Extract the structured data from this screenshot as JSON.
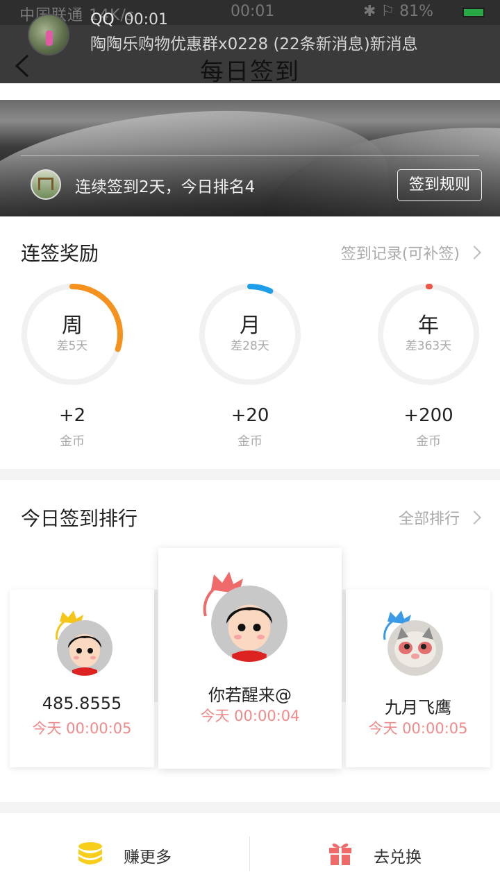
{
  "status_bar": {
    "left": "中国联通 14K/s",
    "clock": "00:01",
    "right": "✱ ⚐ 81%"
  },
  "notification": {
    "app": "QQ",
    "time": "00:01",
    "message": "陶陶乐购物优惠群x0228 (22条新消息)新消息"
  },
  "header": {
    "title": "每日签到"
  },
  "banner": {
    "status_text": "连续签到2天，今日排名4",
    "rules_button": "签到规则"
  },
  "rewards": {
    "title": "连签奖励",
    "record_link": "签到记录(可补签)",
    "items": [
      {
        "period": "周",
        "remaining": "差5天",
        "amount": "+2",
        "unit": "金币",
        "progress": 0.3,
        "color": "#f5921e"
      },
      {
        "period": "月",
        "remaining": "差28天",
        "amount": "+20",
        "unit": "金币",
        "progress": 0.07,
        "color": "#1e9ee8"
      },
      {
        "period": "年",
        "remaining": "差363天",
        "amount": "+200",
        "unit": "金币",
        "progress": 0.005,
        "color": "#f05548"
      }
    ]
  },
  "ranking": {
    "title": "今日签到排行",
    "all_link": "全部排行",
    "entries": [
      {
        "position": "left",
        "name": "485.8555",
        "time": "今天  00:00:05",
        "crown_color": "#f5c518"
      },
      {
        "position": "center",
        "name": "你若醒来@",
        "time": "今天  00:00:04",
        "crown_color": "#f06a6a"
      },
      {
        "position": "right",
        "name": "九月飞鹰",
        "time": "今天  00:00:05",
        "crown_color": "#3a9ae8"
      }
    ]
  },
  "bottom_bar": {
    "earn_more": "赚更多",
    "redeem": "去兑换",
    "earn_icon_color": "#f7cf1a",
    "redeem_icon_color": "#f06a6a"
  }
}
